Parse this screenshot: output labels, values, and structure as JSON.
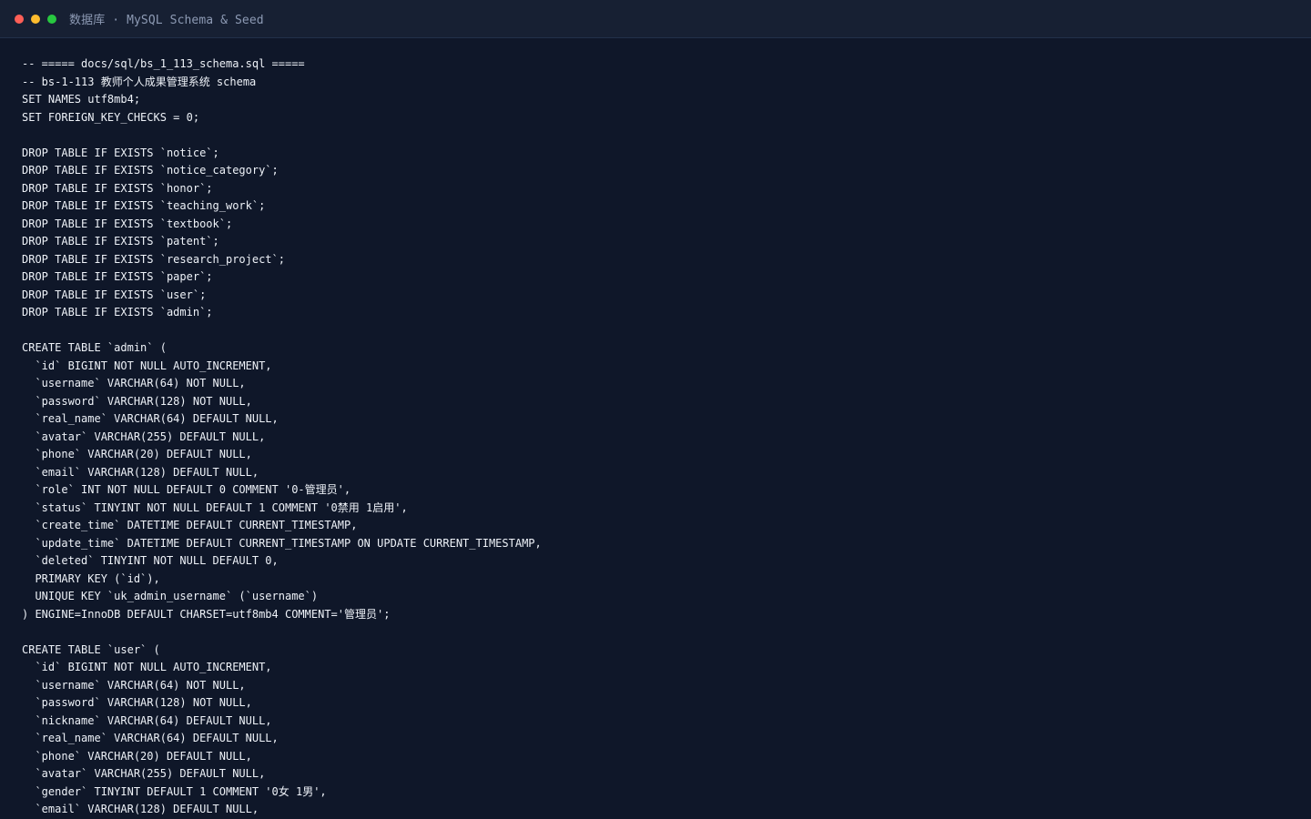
{
  "window": {
    "title": "数据库 · MySQL Schema & Seed",
    "traffic_lights": {
      "close_color": "#ff5f57",
      "minimize_color": "#febc2e",
      "maximize_color": "#28c840"
    }
  },
  "editor": {
    "lines": [
      "-- ===== docs/sql/bs_1_113_schema.sql =====",
      "-- bs-1-113 教师个人成果管理系统 schema",
      "SET NAMES utf8mb4;",
      "SET FOREIGN_KEY_CHECKS = 0;",
      "",
      "DROP TABLE IF EXISTS `notice`;",
      "DROP TABLE IF EXISTS `notice_category`;",
      "DROP TABLE IF EXISTS `honor`;",
      "DROP TABLE IF EXISTS `teaching_work`;",
      "DROP TABLE IF EXISTS `textbook`;",
      "DROP TABLE IF EXISTS `patent`;",
      "DROP TABLE IF EXISTS `research_project`;",
      "DROP TABLE IF EXISTS `paper`;",
      "DROP TABLE IF EXISTS `user`;",
      "DROP TABLE IF EXISTS `admin`;",
      "",
      "CREATE TABLE `admin` (",
      "  `id` BIGINT NOT NULL AUTO_INCREMENT,",
      "  `username` VARCHAR(64) NOT NULL,",
      "  `password` VARCHAR(128) NOT NULL,",
      "  `real_name` VARCHAR(64) DEFAULT NULL,",
      "  `avatar` VARCHAR(255) DEFAULT NULL,",
      "  `phone` VARCHAR(20) DEFAULT NULL,",
      "  `email` VARCHAR(128) DEFAULT NULL,",
      "  `role` INT NOT NULL DEFAULT 0 COMMENT '0-管理员',",
      "  `status` TINYINT NOT NULL DEFAULT 1 COMMENT '0禁用 1启用',",
      "  `create_time` DATETIME DEFAULT CURRENT_TIMESTAMP,",
      "  `update_time` DATETIME DEFAULT CURRENT_TIMESTAMP ON UPDATE CURRENT_TIMESTAMP,",
      "  `deleted` TINYINT NOT NULL DEFAULT 0,",
      "  PRIMARY KEY (`id`),",
      "  UNIQUE KEY `uk_admin_username` (`username`)",
      ") ENGINE=InnoDB DEFAULT CHARSET=utf8mb4 COMMENT='管理员';",
      "",
      "CREATE TABLE `user` (",
      "  `id` BIGINT NOT NULL AUTO_INCREMENT,",
      "  `username` VARCHAR(64) NOT NULL,",
      "  `password` VARCHAR(128) NOT NULL,",
      "  `nickname` VARCHAR(64) DEFAULT NULL,",
      "  `real_name` VARCHAR(64) DEFAULT NULL,",
      "  `phone` VARCHAR(20) DEFAULT NULL,",
      "  `avatar` VARCHAR(255) DEFAULT NULL,",
      "  `gender` TINYINT DEFAULT 1 COMMENT '0女 1男',",
      "  `email` VARCHAR(128) DEFAULT NULL,"
    ]
  }
}
